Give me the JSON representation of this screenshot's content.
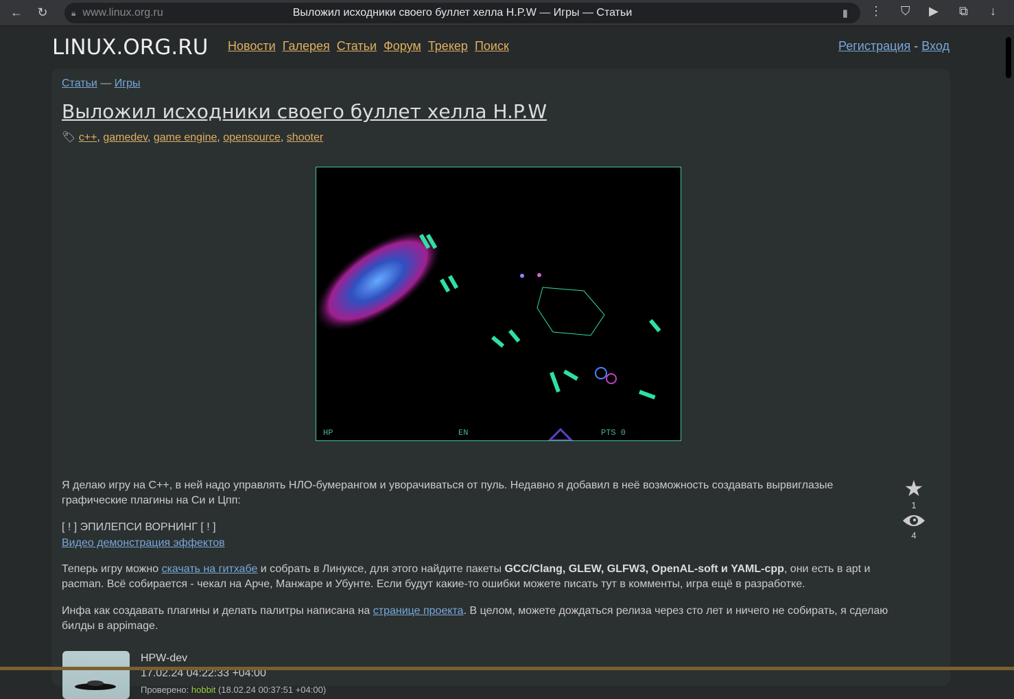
{
  "browser": {
    "url": "www.linux.org.ru",
    "tab_title": "Выложил исходники своего буллет хелла H.P.W — Игры — Статьи"
  },
  "site": {
    "brand": "LINUX.ORG.RU",
    "nav": [
      "Новости",
      "Галерея",
      "Статьи",
      "Форум",
      "Трекер",
      "Поиск"
    ],
    "register": "Регистрация",
    "sep": "-",
    "login": "Вход"
  },
  "article": {
    "breadcrumb": {
      "section": "Статьи",
      "dash": "—",
      "group": "Игры"
    },
    "title": "Выложил исходники своего буллет хелла H.P.W",
    "tags": [
      "c++",
      "gamedev",
      "game engine",
      "opensource",
      "shooter"
    ],
    "hud": {
      "hp": "HP",
      "en": "EN",
      "pts": "PTS 0"
    },
    "p1": "Я делаю игру на C++, в ней надо управлять НЛО-бумерангом и уворачиваться от пуль. Недавно я добавил в неё возможность создавать вырвиглазые графические плагины на Си и Цпп:",
    "warning": "[ ! ] ЭПИЛЕПСИ ВОРНИНГ [ ! ]",
    "video_link": "Видео демонстрация эффектов",
    "p3_a": "Теперь игру можно ",
    "p3_link": "скачать на гитхабе",
    "p3_b": " и собрать в Линуксе, для этого найдите пакеты ",
    "p3_bold": "GCC/Clang, GLEW, GLFW3, OpenAL-soft и YAML-cpp",
    "p3_c": ", они есть в apt и pacman. Всё собирается - чекал на Арче, Манжаре и Убунте. Если будут какие-то ошибки можете писать тут в комменты, игра ещё в разработке.",
    "p4_a": "Инфа как создавать плагины и делать палитры написана на ",
    "p4_link": "странице проекта",
    "p4_b": ". В целом, можете дождаться релиза через сто лет и ничего не собирать, я сделаю билды в appimage.",
    "favorites": "1",
    "watchers": "4",
    "author": "HPW-dev",
    "date": "17.02.24 04:22:33 +04:00",
    "verified_label": "Проверено: ",
    "verified_by": "hobbit",
    "verified_date": "(18.02.24 00:37:51 +04:00)"
  }
}
